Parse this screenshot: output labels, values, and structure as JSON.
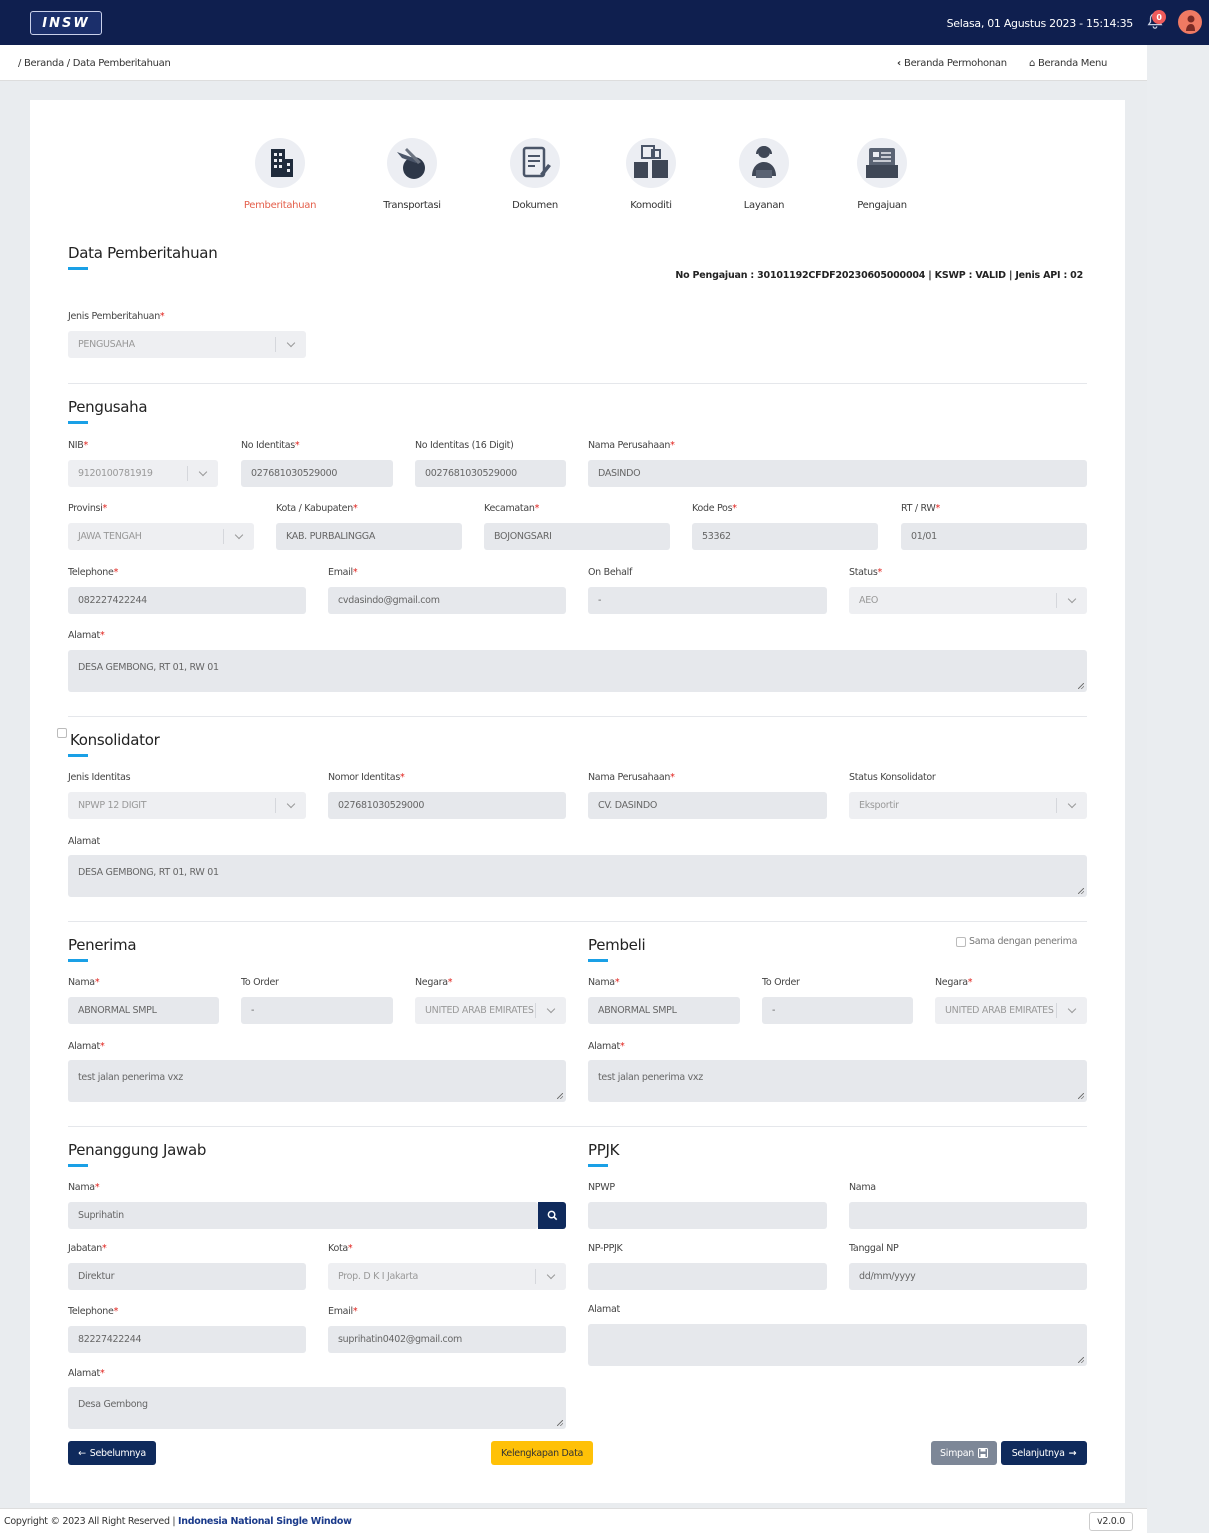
{
  "header": {
    "logo_text": "INSW",
    "datetime": "Selasa, 01 Agustus 2023 - 15:14:35",
    "notif_count": "0"
  },
  "subbar": {
    "breadcrumb": "/ Beranda / Data Pemberitahuan",
    "back_link": "Beranda Permohonan",
    "menu_link": "Beranda Menu"
  },
  "steps": [
    {
      "label": "Pemberitahuan",
      "icon": "building-icon"
    },
    {
      "label": "Transportasi",
      "icon": "plane-globe-icon"
    },
    {
      "label": "Dokumen",
      "icon": "document-icon"
    },
    {
      "label": "Komoditi",
      "icon": "boxes-icon"
    },
    {
      "label": "Layanan",
      "icon": "support-agent-icon"
    },
    {
      "label": "Pengajuan",
      "icon": "folder-icon"
    }
  ],
  "pemberitahuan": {
    "title": "Data Pemberitahuan",
    "info": "No Pengajuan : 30101192CFDF20230605000004 | KSWP : VALID | Jenis API : 02",
    "jenis_label": "Jenis Pemberitahuan",
    "jenis_value": "PENGUSAHA"
  },
  "pengusaha": {
    "title": "Pengusaha",
    "nib_label": "NIB",
    "nib": "9120100781919",
    "no_id_label": "No Identitas",
    "no_id": "027681030529000",
    "no_id16_label": "No Identitas (16 Digit)",
    "no_id16": "0027681030529000",
    "nama_label": "Nama Perusahaan",
    "nama": "DASINDO",
    "provinsi_label": "Provinsi",
    "provinsi": "JAWA TENGAH",
    "kota_label": "Kota / Kabupaten",
    "kota": "KAB. PURBALINGGA",
    "kecamatan_label": "Kecamatan",
    "kecamatan": "BOJONGSARI",
    "kodepos_label": "Kode Pos",
    "kodepos": "53362",
    "rtrw_label": "RT / RW",
    "rtrw": "01/01",
    "telp_label": "Telephone",
    "telp": "082227422244",
    "email_label": "Email",
    "email": "cvdasindo@gmail.com",
    "onbehalf_label": "On Behalf",
    "onbehalf": "-",
    "status_label": "Status",
    "status": "AEO",
    "alamat_label": "Alamat",
    "alamat": "DESA GEMBONG, RT 01, RW 01"
  },
  "konsolidator": {
    "title": "Konsolidator",
    "jenis_label": "Jenis Identitas",
    "jenis": "NPWP 12 DIGIT",
    "nomor_label": "Nomor Identitas",
    "nomor": "027681030529000",
    "nama_label": "Nama Perusahaan",
    "nama": "CV. DASINDO",
    "status_label": "Status Konsolidator",
    "status": "Eksportir",
    "alamat_label": "Alamat",
    "alamat": "DESA GEMBONG, RT 01, RW 01"
  },
  "penerima": {
    "title": "Penerima",
    "nama_label": "Nama",
    "nama": "ABNORMAL SMPL",
    "toorder_label": "To Order",
    "toorder": "-",
    "negara_label": "Negara",
    "negara": "UNITED ARAB EMIRATES",
    "alamat_label": "Alamat",
    "alamat": "test jalan penerima vxz"
  },
  "pembeli": {
    "title": "Pembeli",
    "same_label": "Sama dengan penerima",
    "nama_label": "Nama",
    "nama": "ABNORMAL SMPL",
    "toorder_label": "To Order",
    "toorder": "-",
    "negara_label": "Negara",
    "negara": "UNITED ARAB EMIRATES",
    "alamat_label": "Alamat",
    "alamat": "test jalan penerima vxz"
  },
  "penanggung": {
    "title": "Penanggung Jawab",
    "nama_label": "Nama",
    "nama": "Suprihatin",
    "jabatan_label": "Jabatan",
    "jabatan": "Direktur",
    "kota_label": "Kota",
    "kota": "Prop. D K I Jakarta",
    "telp_label": "Telephone",
    "telp": "82227422244",
    "email_label": "Email",
    "email": "suprihatin0402@gmail.com",
    "alamat_label": "Alamat",
    "alamat": "Desa Gembong"
  },
  "ppjk": {
    "title": "PPJK",
    "npwp_label": "NPWP",
    "nama_label": "Nama",
    "np_label": "NP-PPJK",
    "tanggal_label": "Tanggal NP",
    "tanggal_placeholder": "dd/mm/yyyy",
    "alamat_label": "Alamat"
  },
  "buttons": {
    "prev": "Sebelumnya",
    "kelengkapan": "Kelengkapan Data",
    "simpan": "Simpan",
    "next": "Selanjutnya"
  },
  "footer": {
    "copyright": "Copyright © 2023 All Right Reserved | ",
    "brand": "Indonesia National Single Window",
    "version": "v2.0.0"
  },
  "colors": {
    "navy": "#0f1f4f",
    "accent": "#1aa0e6",
    "active_step": "#e4604c",
    "warning": "#ffc107",
    "primary_btn": "#0f2a5c"
  }
}
